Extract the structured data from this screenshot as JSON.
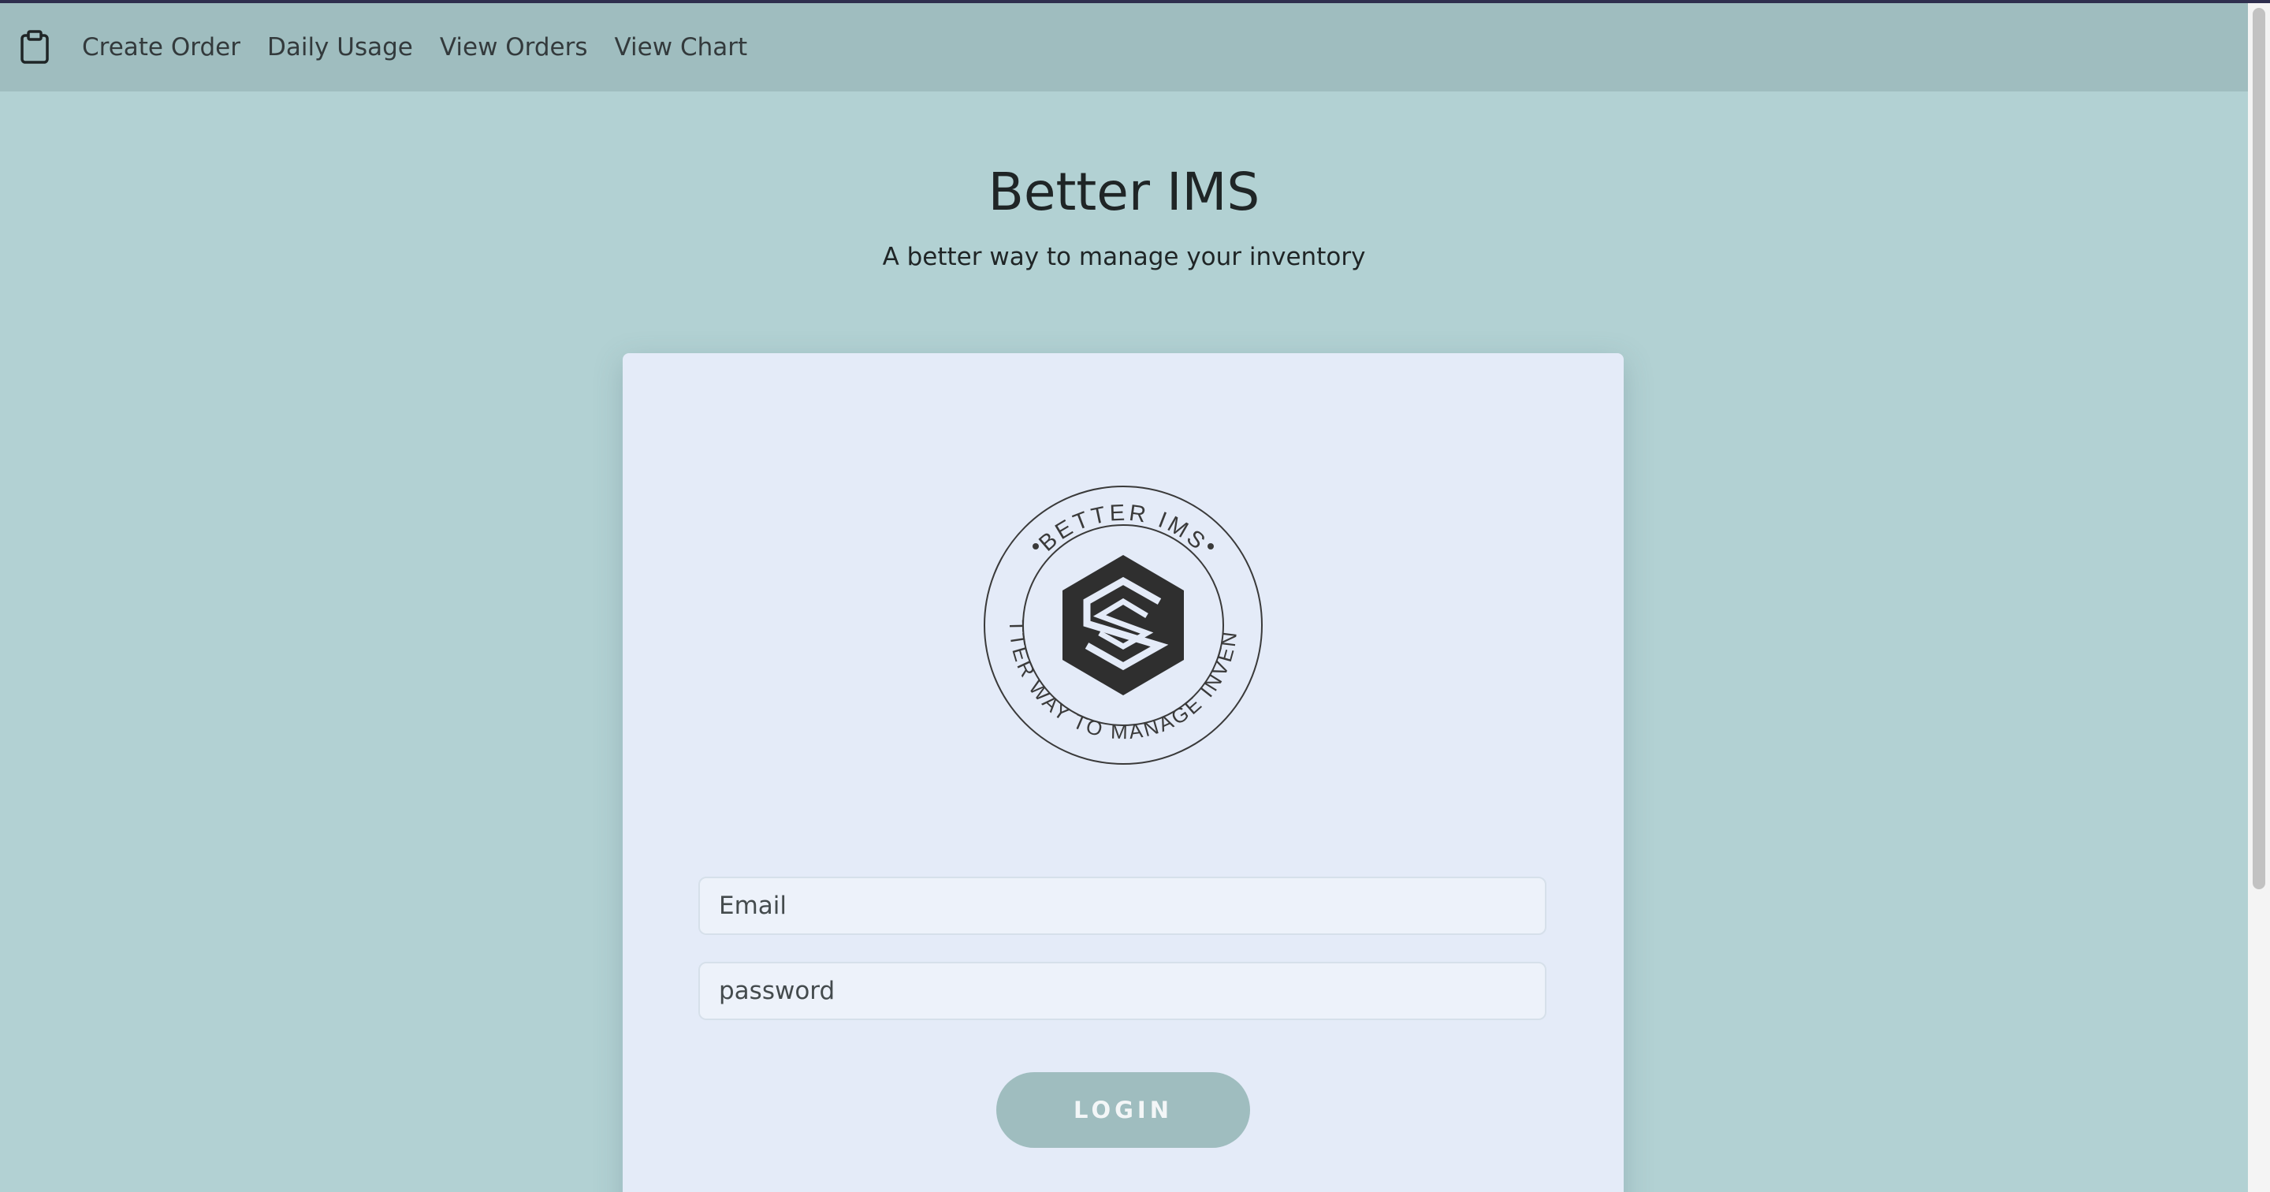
{
  "nav": {
    "logo_icon": "clipboard-icon",
    "links": [
      "Create Order",
      "Daily Usage",
      "View Orders",
      "View Chart"
    ]
  },
  "header": {
    "title": "Better IMS",
    "subtitle": "A better way to manage your inventory"
  },
  "seal": {
    "top_text": "BETTER IMS",
    "ring_text": "A BETTER WAY TO MANAGE INVENTORY",
    "icon": "s-hexagon-logo-icon"
  },
  "login_form": {
    "email_placeholder": "Email",
    "password_placeholder": "password",
    "login_label": "LOGIN"
  },
  "colors": {
    "page_background": "#b2d1d3",
    "navbar": "#9fbdbf",
    "card": "#e4ebf8",
    "button": "#9fbdbf"
  }
}
